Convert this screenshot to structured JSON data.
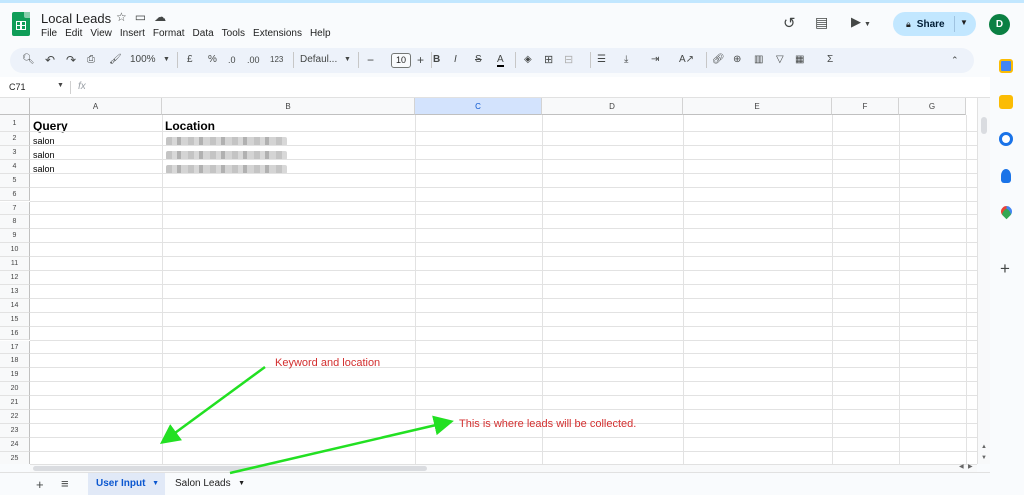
{
  "document": {
    "title": "Local Leads",
    "menu": [
      "File",
      "Edit",
      "View",
      "Insert",
      "Format",
      "Data",
      "Tools",
      "Extensions",
      "Help"
    ]
  },
  "header": {
    "share_label": "Share",
    "avatar_initial": "D",
    "icons": [
      "star-icon",
      "move-to-folder-icon",
      "cloud-saved-icon",
      "history-icon",
      "comments-icon",
      "meet-icon"
    ]
  },
  "toolbar": {
    "zoom": "100%",
    "currency": "£",
    "percent": "%",
    "decrease_decimal": ".0",
    "increase_decimal": ".00",
    "number_format": "123",
    "font": "Defaul...",
    "font_size": "10",
    "sum": "Σ"
  },
  "formula_bar": {
    "name_box": "C71",
    "fx": "fx",
    "value": ""
  },
  "grid": {
    "columns": [
      "A",
      "B",
      "C",
      "D",
      "E",
      "F",
      "G"
    ],
    "selected_column": "C",
    "rows": [
      "1",
      "2",
      "3",
      "4",
      "5",
      "6",
      "7",
      "8",
      "9",
      "10",
      "11",
      "12",
      "13",
      "14",
      "15",
      "16",
      "17",
      "18",
      "19",
      "20",
      "21",
      "22",
      "23",
      "24",
      "25"
    ],
    "headers": {
      "A1": "Query",
      "B1": "Location"
    },
    "values": [
      {
        "row": 2,
        "query": "salon",
        "location_redacted": true
      },
      {
        "row": 3,
        "query": "salon",
        "location_redacted": true
      },
      {
        "row": 4,
        "query": "salon",
        "location_redacted": true
      }
    ]
  },
  "sheets": {
    "tabs": [
      "User Input",
      "Salon Leads"
    ],
    "active": "User Input"
  },
  "side_panel": {
    "icons": [
      "calendar-icon",
      "keep-icon",
      "tasks-icon",
      "contacts-icon",
      "maps-icon",
      "add-icon"
    ]
  },
  "annotations": {
    "keyword": "Keyword and location",
    "leads": "This is where leads will be collected.",
    "color": "#d32f2f",
    "arrow_color": "#22e022"
  }
}
